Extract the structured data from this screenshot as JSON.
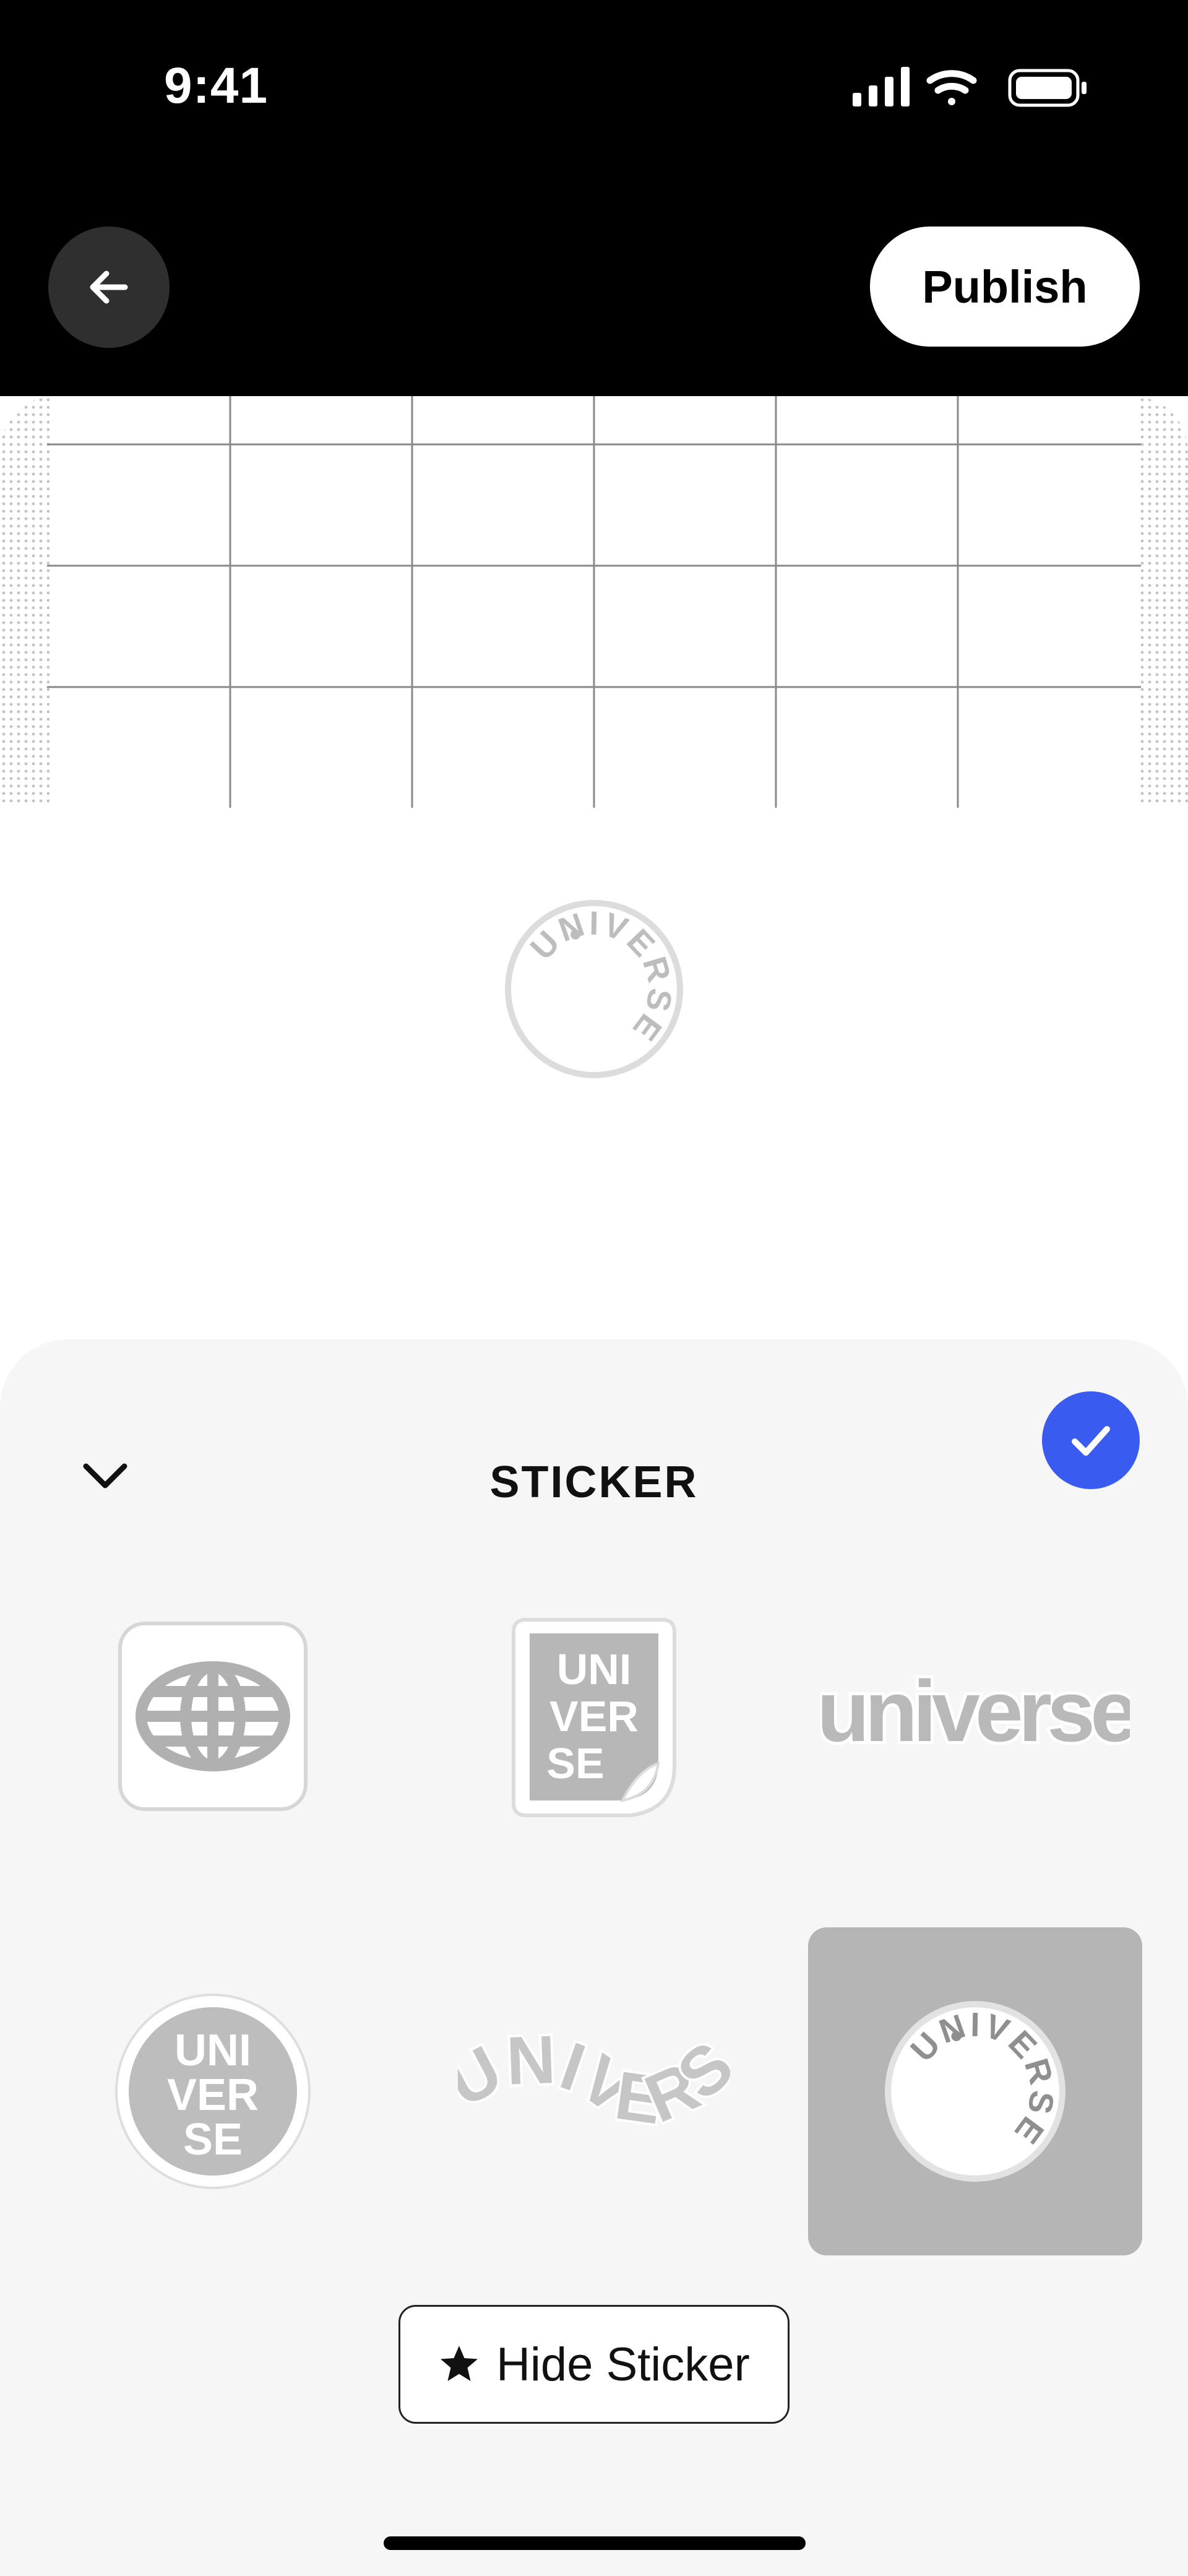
{
  "status_bar": {
    "time": "9:41",
    "icons": [
      "signal-icon",
      "wifi-icon",
      "battery-icon"
    ]
  },
  "header": {
    "back_icon": "arrow-left-icon",
    "publish_label": "Publish"
  },
  "canvas": {
    "background": "grid",
    "placed_sticker": "Universe circular badge"
  },
  "sheet": {
    "title": "STICKER",
    "collapse_icon": "chevron-down-icon",
    "confirm_icon": "checkmark-icon",
    "accent": "#3a5bef",
    "stickers": [
      {
        "name": "Globe app icon",
        "selected": false
      },
      {
        "name": "Universe peel sticker",
        "selected": false,
        "text": "UNIVERSE"
      },
      {
        "name": "Universe wordmark",
        "selected": false,
        "text": "universe"
      },
      {
        "name": "Universe round badge",
        "selected": false,
        "text": "UNIVERSE"
      },
      {
        "name": "Universe wavy text",
        "selected": false,
        "text": "UNIVERSE"
      },
      {
        "name": "Universe circular badge",
        "selected": true,
        "text": "UNIVERSE"
      }
    ],
    "hide_sticker_label": "Hide Sticker",
    "hide_sticker_icon": "star-icon"
  }
}
